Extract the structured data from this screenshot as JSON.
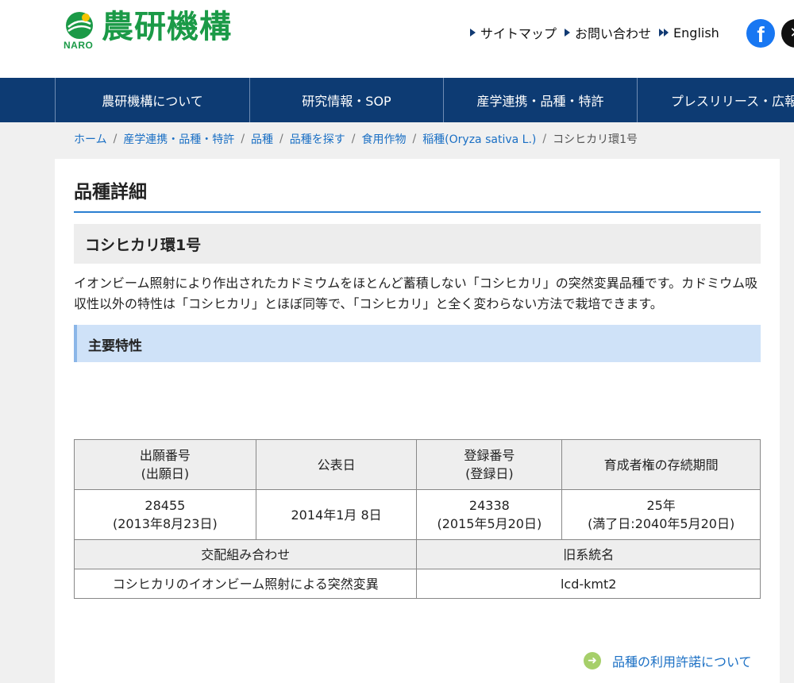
{
  "header": {
    "logo_text": "農研機構",
    "logo_sub": "NARO",
    "util_links": [
      "サイトマップ",
      "お問い合わせ",
      "English"
    ],
    "sns": [
      "facebook-icon",
      "x-icon"
    ],
    "brand_color": "#1b9a47"
  },
  "nav": {
    "items": [
      "農研機構について",
      "研究情報・SOP",
      "産学連携・品種・特許",
      "プレスリリース・広報"
    ],
    "bg_color": "#0d3b73"
  },
  "breadcrumb": {
    "items": [
      "ホーム",
      "産学連携・品種・特許",
      "品種",
      "品種を探す",
      "食用作物",
      "稲種(Oryza sativa L.)"
    ],
    "current": "コシヒカリ環1号",
    "separator": "/"
  },
  "page": {
    "title": "品種詳細",
    "variety_name": "コシヒカリ環1号",
    "description": "イオンビーム照射により作出されたカドミウムをほとんど蓄積しない「コシヒカリ」の突然変異品種です。カドミウム吸収性以外の特性は「コシヒカリ」とほぼ同等で、「コシヒカリ」と全く変わらない方法で栽培できます。",
    "feature_heading": "主要特性"
  },
  "table": {
    "headers": [
      {
        "line1": "出願番号",
        "line2": "(出願日)"
      },
      {
        "line1": "公表日",
        "line2": ""
      },
      {
        "line1": "登録番号",
        "line2": "(登録日)"
      },
      {
        "line1": "育成者権の存続期間",
        "line2": ""
      }
    ],
    "values": [
      {
        "line1": "28455",
        "line2": "(2013年8月23日)"
      },
      {
        "line1": "2014年1月 8日",
        "line2": ""
      },
      {
        "line1": "24338",
        "line2": "(2015年5月20日)"
      },
      {
        "line1": "25年",
        "line2": "(満了日:2040年5月20日)"
      }
    ],
    "cross_header": "交配組み合わせ",
    "old_name_header": "旧系統名",
    "cross_value": "コシヒカリのイオンビーム照射による突然変異",
    "old_name_value": "lcd-kmt2"
  },
  "footer_link": {
    "label": "品種の利用許諾について",
    "icon": "arrow-right-circle-icon"
  }
}
